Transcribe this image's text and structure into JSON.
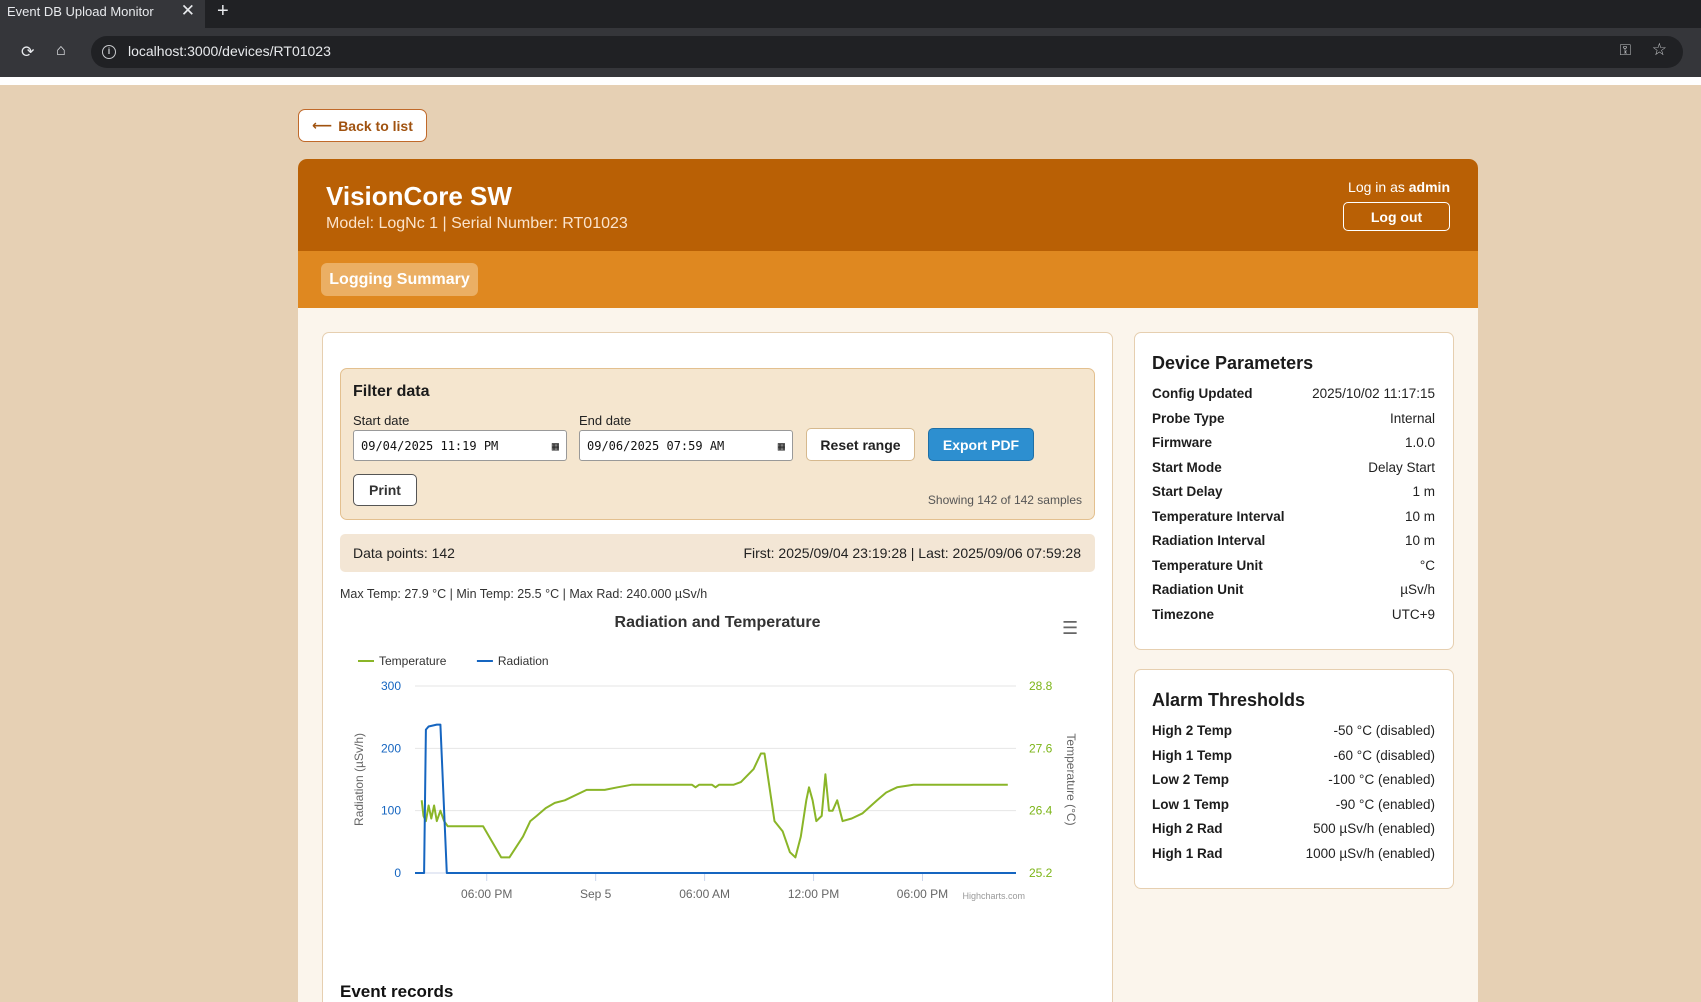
{
  "browser": {
    "tab_title": "Event DB Upload Monitor",
    "tab_close": "✕",
    "new_tab": "+",
    "url": "localhost:3000/devices/RT01023"
  },
  "page": {
    "back_label": "Back to list",
    "back_arrow": "⟵"
  },
  "header": {
    "device_name": "VisionCore SW",
    "subtitle": "Model: LogNc 1 | Serial Number: RT01023",
    "login_prefix": "Log in as ",
    "login_user": "admin",
    "logout_label": "Log out",
    "accent_color": "#b96005"
  },
  "subnav": {
    "tab_label": "Logging Summary"
  },
  "filter": {
    "title": "Filter data",
    "start_label": "Start date",
    "start_value": "09/04/2025  11:19  PM",
    "end_label": "End date",
    "end_value": "09/06/2025  07:59  AM",
    "reset_label": "Reset range",
    "export_label": "Export PDF",
    "print_label": "Print",
    "showing": "Showing 142 of 142 samples"
  },
  "summary": {
    "data_points": "Data points: 142",
    "range": "First: 2025/09/04 23:19:28 | Last: 2025/09/06 07:59:28",
    "minmax": "Max Temp: 27.9 °C | Min Temp: 25.5 °C | Max Rad: 240.000 µSv/h"
  },
  "event_records_title": "Event records",
  "chart_data": {
    "type": "line",
    "title": "Radiation and Temperature",
    "credits": "Highcharts.com",
    "legend_position": "top-left",
    "x_ticks": [
      "06:00 PM",
      "Sep 5",
      "06:00 AM",
      "12:00 PM",
      "06:00 PM"
    ],
    "x_tick_hours": [
      0,
      6,
      12,
      18,
      24
    ],
    "xlim_hours": [
      -3.95,
      29.15
    ],
    "y_left": {
      "label": "Radiation (µSv/h)",
      "ticks": [
        "300",
        "200",
        "100",
        "0"
      ],
      "range": [
        0,
        300
      ],
      "color": "#1565c0"
    },
    "y_right": {
      "label": "Temperature (°C)",
      "ticks": [
        "28.8",
        "27.6",
        "26.4",
        "25.2"
      ],
      "range": [
        25.2,
        28.8
      ],
      "color": "#7cb518"
    },
    "grid": true,
    "series": [
      {
        "name": "Temperature",
        "color": "#8ab528",
        "points": [
          [
            -3.58,
            26.6
          ],
          [
            -3.48,
            26.3
          ],
          [
            -3.35,
            26.2
          ],
          [
            -3.2,
            26.5
          ],
          [
            -3.05,
            26.25
          ],
          [
            -2.9,
            26.5
          ],
          [
            -2.75,
            26.2
          ],
          [
            -2.55,
            26.4
          ],
          [
            -2.35,
            26.2
          ],
          [
            -2.15,
            26.1
          ],
          [
            -1.7,
            26.1
          ],
          [
            -0.2,
            26.1
          ],
          [
            0.8,
            25.5
          ],
          [
            1.25,
            25.5
          ],
          [
            2.0,
            25.9
          ],
          [
            2.4,
            26.2
          ],
          [
            2.75,
            26.3
          ],
          [
            3.25,
            26.45
          ],
          [
            3.75,
            26.55
          ],
          [
            4.3,
            26.6
          ],
          [
            5.5,
            26.8
          ],
          [
            6.5,
            26.8
          ],
          [
            7.2,
            26.85
          ],
          [
            8.0,
            26.9
          ],
          [
            11.3,
            26.9
          ],
          [
            11.5,
            26.85
          ],
          [
            11.7,
            26.9
          ],
          [
            12.4,
            26.9
          ],
          [
            12.6,
            26.85
          ],
          [
            12.8,
            26.9
          ],
          [
            13.6,
            26.9
          ],
          [
            14.0,
            26.95
          ],
          [
            14.7,
            27.2
          ],
          [
            15.1,
            27.5
          ],
          [
            15.3,
            27.5
          ],
          [
            15.55,
            26.9
          ],
          [
            15.85,
            26.2
          ],
          [
            16.3,
            26.0
          ],
          [
            16.7,
            25.6
          ],
          [
            17.0,
            25.5
          ],
          [
            17.3,
            25.9
          ],
          [
            17.6,
            26.6
          ],
          [
            17.75,
            26.85
          ],
          [
            17.95,
            26.6
          ],
          [
            18.15,
            26.2
          ],
          [
            18.45,
            26.3
          ],
          [
            18.65,
            27.1
          ],
          [
            18.85,
            26.4
          ],
          [
            19.05,
            26.4
          ],
          [
            19.3,
            26.6
          ],
          [
            19.6,
            26.2
          ],
          [
            20.1,
            26.25
          ],
          [
            20.7,
            26.35
          ],
          [
            21.5,
            26.6
          ],
          [
            22.0,
            26.75
          ],
          [
            22.6,
            26.85
          ],
          [
            23.5,
            26.9
          ],
          [
            28.7,
            26.9
          ]
        ]
      },
      {
        "name": "Radiation",
        "color": "#1565c0",
        "points": [
          [
            -3.95,
            0
          ],
          [
            -3.45,
            0
          ],
          [
            -3.35,
            230
          ],
          [
            -3.2,
            235
          ],
          [
            -2.75,
            238
          ],
          [
            -2.55,
            238
          ],
          [
            -2.2,
            0
          ],
          [
            29.15,
            0
          ]
        ]
      }
    ]
  },
  "device_params": {
    "title": "Device Parameters",
    "rows": [
      {
        "k": "Config Updated",
        "v": "2025/10/02 11:17:15"
      },
      {
        "k": "Probe Type",
        "v": "Internal"
      },
      {
        "k": "Firmware",
        "v": "1.0.0"
      },
      {
        "k": "Start Mode",
        "v": "Delay Start"
      },
      {
        "k": "Start Delay",
        "v": "1 m"
      },
      {
        "k": "Temperature Interval",
        "v": "10 m"
      },
      {
        "k": "Radiation Interval",
        "v": "10 m"
      },
      {
        "k": "Temperature Unit",
        "v": "°C"
      },
      {
        "k": "Radiation Unit",
        "v": "µSv/h"
      },
      {
        "k": "Timezone",
        "v": "UTC+9"
      }
    ]
  },
  "alarm_thresholds": {
    "title": "Alarm Thresholds",
    "rows": [
      {
        "k": "High 2 Temp",
        "v": "-50 °C (disabled)"
      },
      {
        "k": "High 1 Temp",
        "v": "-60 °C (disabled)"
      },
      {
        "k": "Low 2 Temp",
        "v": "-100 °C (enabled)"
      },
      {
        "k": "Low 1 Temp",
        "v": "-90 °C (enabled)"
      },
      {
        "k": "High 2 Rad",
        "v": "500 µSv/h (enabled)"
      },
      {
        "k": "High 1 Rad",
        "v": "1000 µSv/h (enabled)"
      }
    ]
  }
}
